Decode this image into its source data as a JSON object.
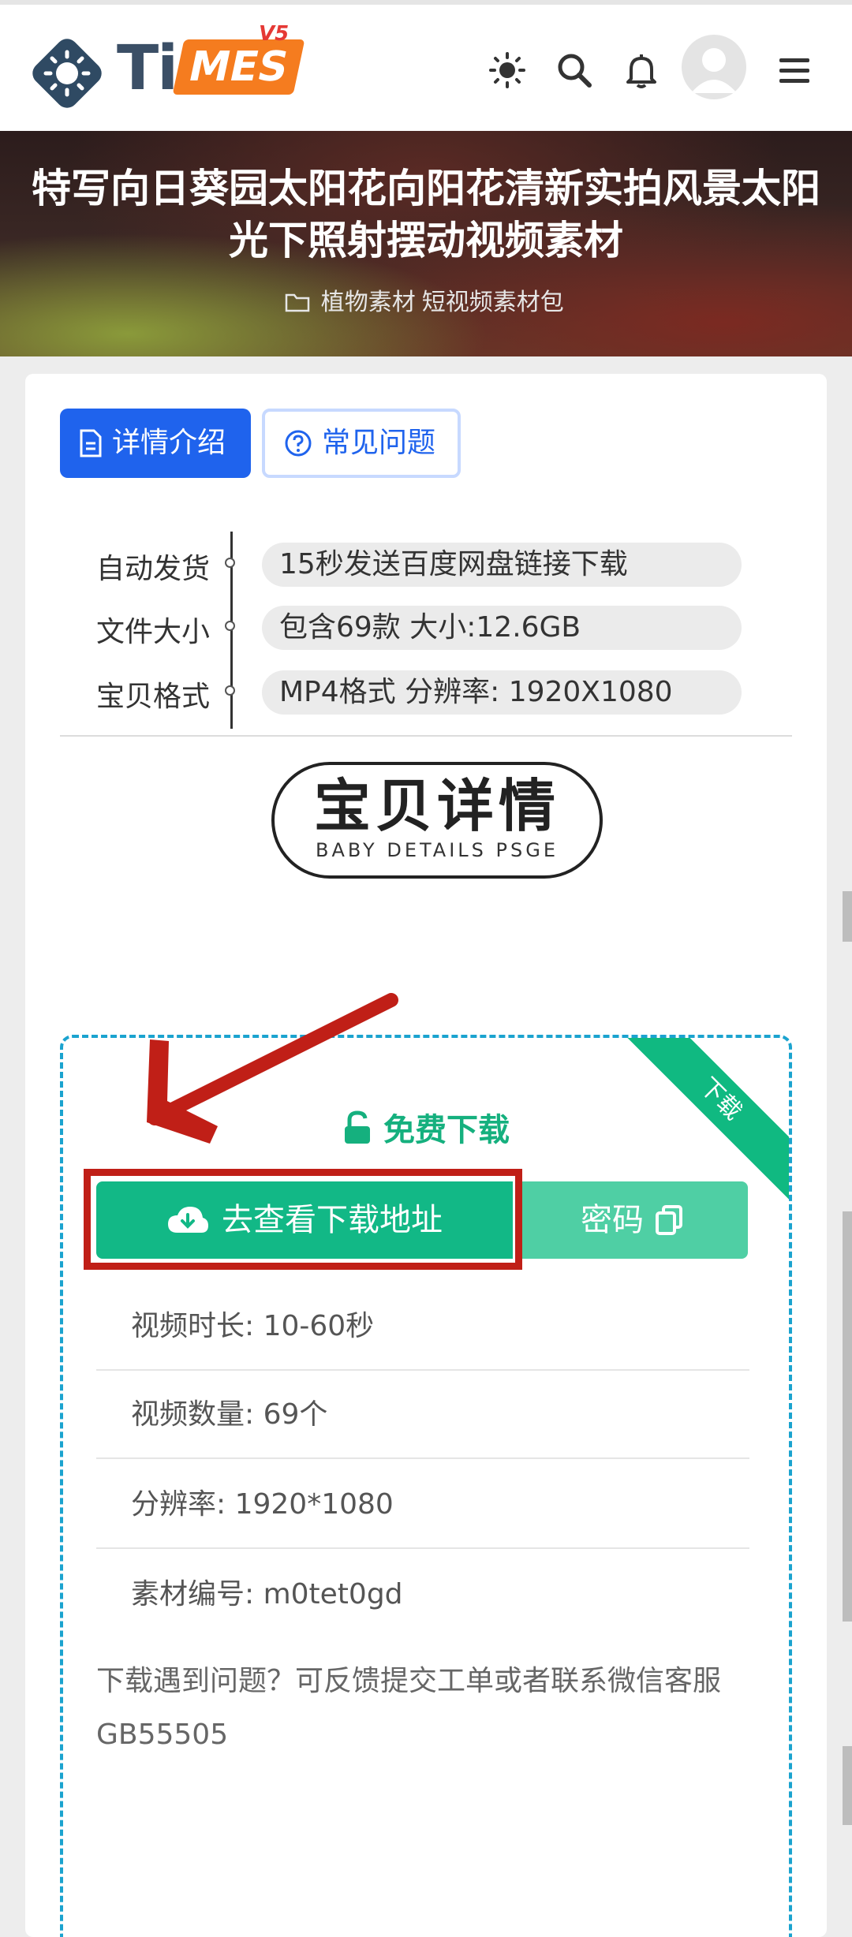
{
  "header": {
    "logo_ti": "Ti",
    "logo_mes": "MES",
    "logo_version": "V5",
    "icons": [
      "theme-icon",
      "search-icon",
      "bell-icon",
      "avatar",
      "menu-icon"
    ]
  },
  "hero": {
    "title": "特写向日葵园太阳花向阳花清新实拍风景太阳光下照射摆动视频素材",
    "categories": [
      "植物素材",
      "短视频素材包"
    ]
  },
  "tabs": [
    {
      "label": "详情介绍",
      "active": true
    },
    {
      "label": "常见问题",
      "active": false
    }
  ],
  "info": [
    {
      "label": "自动发货",
      "value": "15秒发送百度网盘链接下载"
    },
    {
      "label": "文件大小",
      "value": "包含69款 大小:12.6GB"
    },
    {
      "label": "宝贝格式",
      "value": "MP4格式 分辨率: 1920X1080"
    }
  ],
  "badge": {
    "title": "宝贝详情",
    "subtitle": "BABY DETAILS PSGE"
  },
  "download": {
    "ribbon": "下载",
    "title": "免费下载",
    "button_label": "去查看下载地址",
    "password_label": "密码",
    "specs": [
      "视频时长: 10-60秒",
      "视频数量: 69个",
      "分辨率: 1920*1080",
      "素材编号: m0tet0gd"
    ],
    "note": "下载遇到问题？可反馈提交工单或者联系微信客服GB55505"
  },
  "colors": {
    "primary_blue": "#1f63ed",
    "green": "#12b886",
    "green_light": "#4fcfa4",
    "annotation_red": "#c01f17",
    "logo_orange": "#f57c1f"
  }
}
